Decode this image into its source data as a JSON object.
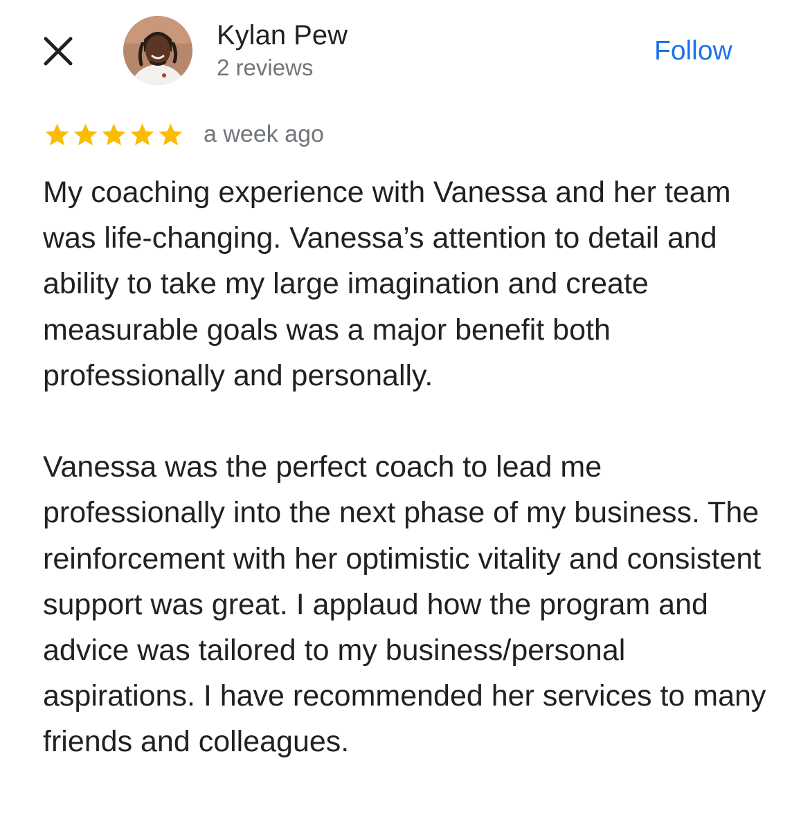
{
  "header": {
    "close_icon": "close-icon",
    "avatar_icon": "reviewer-avatar",
    "reviewer_name": "Kylan Pew",
    "review_count": "2 reviews",
    "follow_label": "Follow"
  },
  "review": {
    "rating": 5,
    "rating_max": 5,
    "star_color": "#fbbc04",
    "date": "a week ago",
    "paragraphs": [
      "My coaching experience with Vanessa and her team was life-changing. Vanessa’s attention to detail and ability to take my large imagination and create measurable goals was a major benefit both professionally and personally.",
      "Vanessa was the perfect coach to lead me professionally into the next phase of my business. The reinforcement with her optimistic vitality and consistent support was great. I applaud how the program and advice was tailored to my business/personal aspirations. I have recommended her services to many friends and colleagues."
    ]
  },
  "colors": {
    "accent": "#1a73e8",
    "text_primary": "#202124",
    "text_secondary": "#70757a",
    "star": "#fbbc04"
  }
}
